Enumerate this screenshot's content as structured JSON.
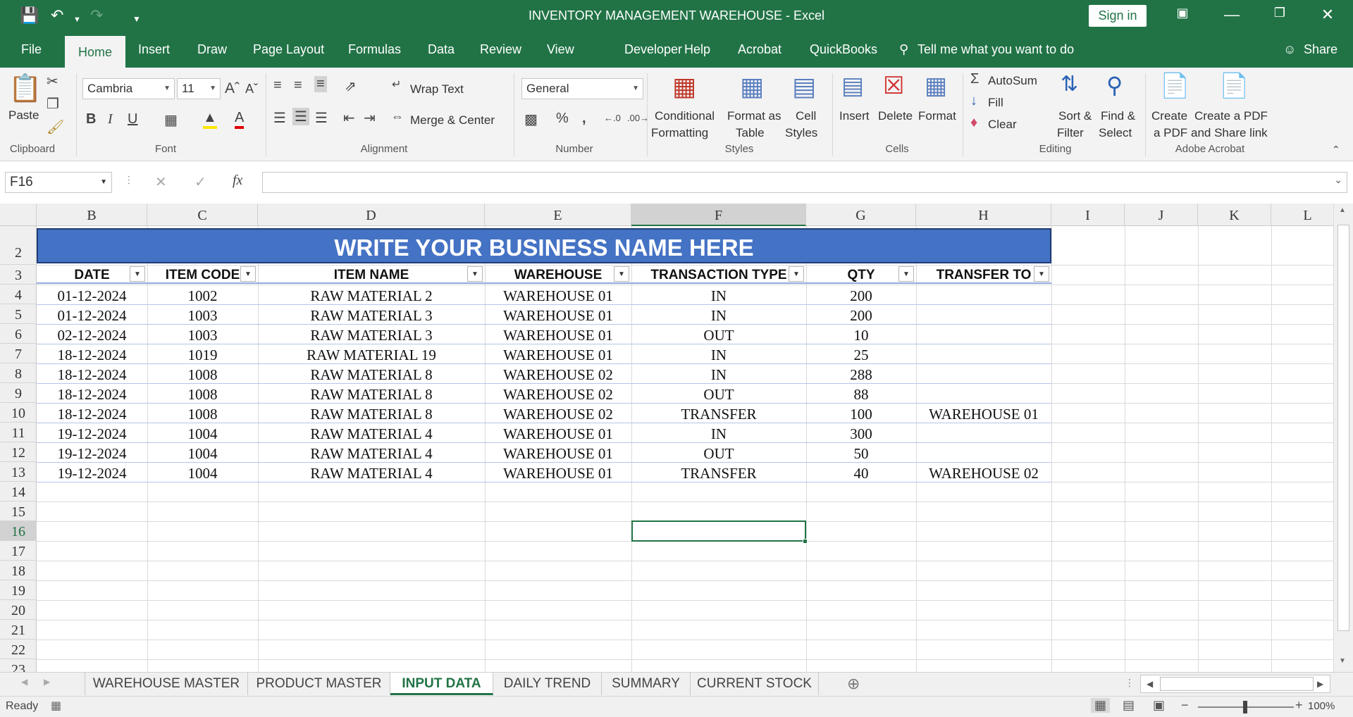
{
  "window": {
    "title": "INVENTORY MANAGEMENT WAREHOUSE  -  Excel",
    "sign_in": "Sign in"
  },
  "ribbon_tabs": [
    "File",
    "Home",
    "Insert",
    "Draw",
    "Page Layout",
    "Formulas",
    "Data",
    "Review",
    "View",
    "Developer",
    "Help",
    "Acrobat",
    "QuickBooks"
  ],
  "tell_me": "Tell me what you want to do",
  "share": "Share",
  "ribbon": {
    "clipboard": {
      "paste": "Paste",
      "label": "Clipboard"
    },
    "font": {
      "name": "Cambria",
      "size": "11",
      "label": "Font"
    },
    "alignment": {
      "wrap": "Wrap Text",
      "merge": "Merge & Center",
      "label": "Alignment"
    },
    "number": {
      "format": "General",
      "label": "Number"
    },
    "styles": {
      "conditional": "Conditional",
      "conditional2": "Formatting",
      "format_as": "Format as",
      "format_as2": "Table",
      "cell": "Cell",
      "cell2": "Styles",
      "label": "Styles"
    },
    "cells": {
      "insert": "Insert",
      "delete": "Delete",
      "format": "Format",
      "label": "Cells"
    },
    "editing": {
      "autosum": "AutoSum",
      "fill": "Fill",
      "clear": "Clear",
      "sort": "Sort &",
      "sort2": "Filter",
      "find": "Find &",
      "find2": "Select",
      "label": "Editing"
    },
    "acrobat": {
      "create": "Create",
      "create2": "a PDF",
      "share": "Create a PDF",
      "share2": "and Share link",
      "label": "Adobe Acrobat"
    }
  },
  "name_box": "F16",
  "columns": [
    "B",
    "C",
    "D",
    "E",
    "F",
    "G",
    "H",
    "I",
    "J",
    "K",
    "L"
  ],
  "selected_column": "F",
  "rows": [
    "2",
    "3",
    "4",
    "5",
    "6",
    "7",
    "8",
    "9",
    "10",
    "11",
    "12",
    "13",
    "14",
    "15",
    "16",
    "17",
    "18",
    "19",
    "20",
    "21",
    "22",
    "23"
  ],
  "selected_row": "16",
  "banner": "WRITE YOUR BUSINESS NAME HERE",
  "table": {
    "headers": [
      "DATE",
      "ITEM CODE",
      "ITEM NAME",
      "WAREHOUSE",
      "TRANSACTION TYPE",
      "QTY",
      "TRANSFER TO"
    ],
    "rows": [
      [
        "01-12-2024",
        "1002",
        "RAW MATERIAL 2",
        "WAREHOUSE 01",
        "IN",
        "200",
        ""
      ],
      [
        "01-12-2024",
        "1003",
        "RAW MATERIAL 3",
        "WAREHOUSE 01",
        "IN",
        "200",
        ""
      ],
      [
        "02-12-2024",
        "1003",
        "RAW MATERIAL 3",
        "WAREHOUSE 01",
        "OUT",
        "10",
        ""
      ],
      [
        "18-12-2024",
        "1019",
        "RAW MATERIAL 19",
        "WAREHOUSE 01",
        "IN",
        "25",
        ""
      ],
      [
        "18-12-2024",
        "1008",
        "RAW MATERIAL 8",
        "WAREHOUSE 02",
        "IN",
        "288",
        ""
      ],
      [
        "18-12-2024",
        "1008",
        "RAW MATERIAL 8",
        "WAREHOUSE 02",
        "OUT",
        "88",
        ""
      ],
      [
        "18-12-2024",
        "1008",
        "RAW MATERIAL 8",
        "WAREHOUSE 02",
        "TRANSFER",
        "100",
        "WAREHOUSE 01"
      ],
      [
        "19-12-2024",
        "1004",
        "RAW MATERIAL 4",
        "WAREHOUSE 01",
        "IN",
        "300",
        ""
      ],
      [
        "19-12-2024",
        "1004",
        "RAW MATERIAL 4",
        "WAREHOUSE 01",
        "OUT",
        "50",
        ""
      ],
      [
        "19-12-2024",
        "1004",
        "RAW MATERIAL 4",
        "WAREHOUSE 01",
        "TRANSFER",
        "40",
        "WAREHOUSE 02"
      ]
    ]
  },
  "sheet_tabs": [
    "WAREHOUSE MASTER",
    "PRODUCT MASTER",
    "INPUT DATA",
    "DAILY TREND",
    "SUMMARY",
    "CURRENT STOCK"
  ],
  "active_sheet": "INPUT DATA",
  "status": {
    "ready": "Ready",
    "zoom": "100%"
  },
  "colors": {
    "excel_green": "#217346",
    "banner_blue": "#4472c4"
  }
}
